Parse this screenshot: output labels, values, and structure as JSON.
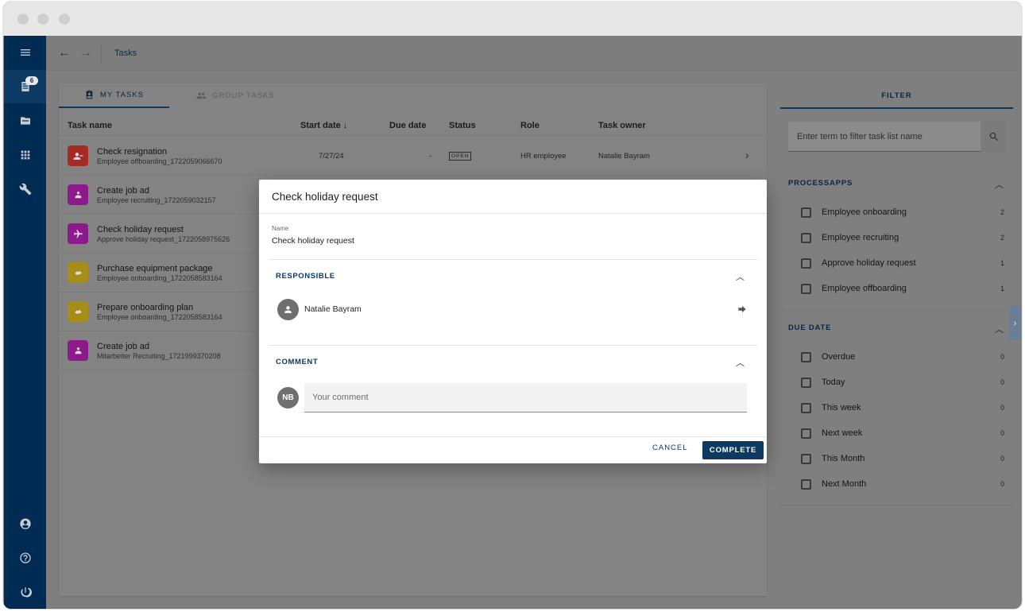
{
  "sidebar": {
    "badge_count": "6",
    "icons": [
      "menu-icon",
      "task-list-icon",
      "folder-icon",
      "apps-grid-icon",
      "wrench-icon",
      "account-circle-icon",
      "help-icon",
      "power-icon"
    ]
  },
  "topbar": {
    "breadcrumb": "Tasks"
  },
  "tabs": {
    "my_tasks": "MY TASKS",
    "group_tasks": "GROUP TASKS"
  },
  "table": {
    "columns": {
      "task_name": "Task name",
      "start_date": "Start date ↓",
      "due_date": "Due date",
      "status": "Status",
      "role": "Role",
      "task_owner": "Task owner"
    },
    "rows": [
      {
        "name": "Check resignation",
        "process": "Employee offboarding_1722059066670",
        "start_date": "7/27/24",
        "due_date": "-",
        "status": "OPEN",
        "role": "HR employee",
        "owner": "Natalie Bayram",
        "icon": "person-remove-icon",
        "icon_color": "#a52a22"
      },
      {
        "name": "Create job ad",
        "process": "Employee recruiting_1722059032157",
        "icon": "person-badge-icon",
        "icon_color": "#8d1a8b"
      },
      {
        "name": "Check holiday request",
        "process": "Approve holiday request_1722058975626",
        "icon": "airplane-icon",
        "icon_color": "#8d1a8b"
      },
      {
        "name": "Purchase equipment package",
        "process": "Employee onboarding_1722058583164",
        "icon": "handshake-icon",
        "icon_color": "#a58d18"
      },
      {
        "name": "Prepare onboarding plan",
        "process": "Employee onboarding_1722058583164",
        "icon": "handshake-icon",
        "icon_color": "#a58d18"
      },
      {
        "name": "Create job ad",
        "process": "Mitarbeiter Recruiting_1721999370208",
        "icon": "person-badge-icon",
        "icon_color": "#8d1a8b"
      }
    ]
  },
  "filter": {
    "title": "FILTER",
    "search_placeholder": "Enter term to filter task list name",
    "processapps": {
      "title": "PROCESSAPPS",
      "items": [
        {
          "label": "Employee onboarding",
          "count": "2"
        },
        {
          "label": "Employee recruiting",
          "count": "2"
        },
        {
          "label": "Approve holiday request",
          "count": "1"
        },
        {
          "label": "Employee offboarding",
          "count": "1"
        }
      ]
    },
    "due_date": {
      "title": "DUE DATE",
      "items": [
        {
          "label": "Overdue",
          "count": "0"
        },
        {
          "label": "Today",
          "count": "0"
        },
        {
          "label": "This week",
          "count": "0"
        },
        {
          "label": "Next week",
          "count": "0"
        },
        {
          "label": "This Month",
          "count": "0"
        },
        {
          "label": "Next Month",
          "count": "0"
        }
      ]
    }
  },
  "modal": {
    "title": "Check holiday request",
    "name_label": "Name",
    "name_value": "Check holiday request",
    "responsible": {
      "title": "RESPONSIBLE",
      "person": "Natalie Bayram"
    },
    "comment": {
      "title": "COMMENT",
      "initials": "NB",
      "placeholder": "Your comment"
    },
    "cancel_label": "CANCEL",
    "complete_label": "COMPLETE"
  }
}
